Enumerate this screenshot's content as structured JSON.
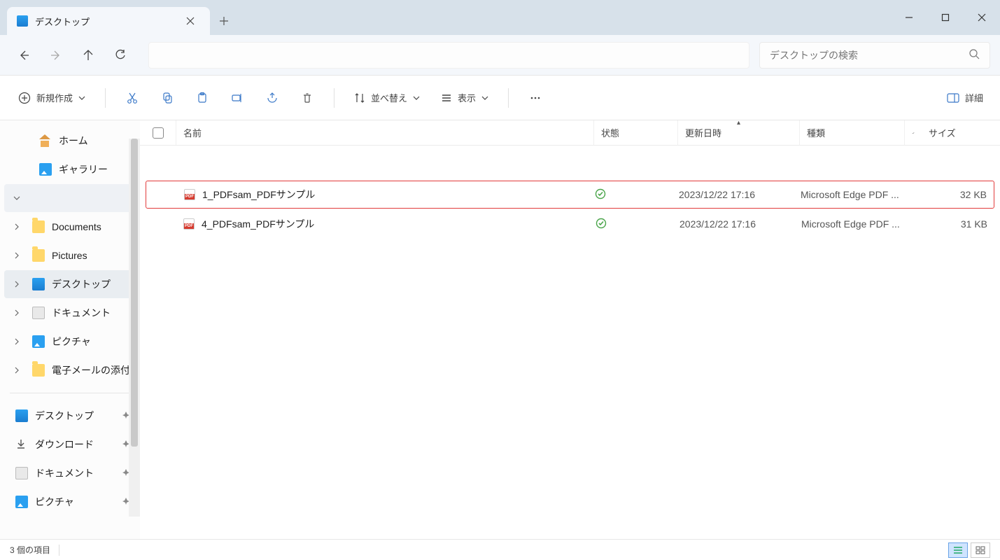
{
  "tab": {
    "label": "デスクトップ"
  },
  "search": {
    "placeholder": "デスクトップの検索"
  },
  "toolbar": {
    "new_label": "新規作成",
    "sort_label": "並べ替え",
    "view_label": "表示",
    "details_label": "詳細"
  },
  "sidebar": {
    "top": [
      {
        "label": "ホーム",
        "icon": "home"
      },
      {
        "label": "ギャラリー",
        "icon": "pic"
      }
    ],
    "blank": {
      "label": ""
    },
    "folders": [
      {
        "label": "Documents",
        "icon": "folder"
      },
      {
        "label": "Pictures",
        "icon": "folder"
      },
      {
        "label": "デスクトップ",
        "icon": "desktop",
        "active": true
      },
      {
        "label": "ドキュメント",
        "icon": "doc"
      },
      {
        "label": "ピクチャ",
        "icon": "pic"
      },
      {
        "label": "電子メールの添付",
        "icon": "folder"
      }
    ],
    "pinned": [
      {
        "label": "デスクトップ",
        "icon": "desktop"
      },
      {
        "label": "ダウンロード",
        "icon": "download"
      },
      {
        "label": "ドキュメント",
        "icon": "doc"
      },
      {
        "label": "ピクチャ",
        "icon": "pic"
      }
    ]
  },
  "columns": {
    "name": "名前",
    "state": "状態",
    "date": "更新日時",
    "kind": "種類",
    "size": "サイズ"
  },
  "files": [
    {
      "name": "1_PDFsam_PDFサンプル",
      "date": "2023/12/22 17:16",
      "kind": "Microsoft Edge PDF ...",
      "size": "32 KB",
      "highlight": true
    },
    {
      "name": "4_PDFsam_PDFサンプル",
      "date": "2023/12/22 17:16",
      "kind": "Microsoft Edge PDF ...",
      "size": "31 KB",
      "highlight": false
    }
  ],
  "status": {
    "count": "3 個の項目"
  }
}
